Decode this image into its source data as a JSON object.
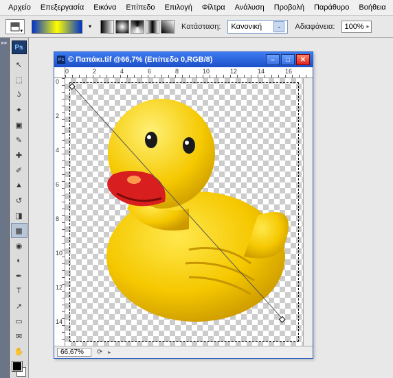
{
  "menubar": [
    "Αρχείο",
    "Επεξεργασία",
    "Εικόνα",
    "Επίπεδο",
    "Επιλογή",
    "Φίλτρα",
    "Ανάλυση",
    "Προβολή",
    "Παράθυρο",
    "Βοήθεια"
  ],
  "options": {
    "mode_label": "Κατάσταση:",
    "mode_value": "Κανονική",
    "opacity_label": "Αδιαφάνεια:",
    "opacity_value": "100%"
  },
  "document": {
    "title": "© Παπάκι.tif @66,7% (Επίπεδο 0,RGB/8)",
    "zoom": "66,67%",
    "ruler_h": [
      "0",
      "2",
      "4",
      "6",
      "8",
      "10",
      "12",
      "14",
      "16"
    ],
    "ruler_v": [
      "0",
      "2",
      "4",
      "6",
      "8",
      "10",
      "12",
      "14"
    ]
  },
  "tools": [
    "move",
    "marquee",
    "lasso",
    "wand",
    "crop",
    "eyedropper",
    "heal",
    "brush",
    "stamp",
    "history",
    "eraser",
    "gradient",
    "blur",
    "dodge",
    "pen",
    "type",
    "path",
    "shape",
    "notes",
    "hand"
  ],
  "icons": {
    "move": "↖",
    "marquee": "⬚",
    "lasso": "ʖ",
    "wand": "✦",
    "crop": "▣",
    "eyedropper": "✎",
    "heal": "✚",
    "brush": "✐",
    "stamp": "▲",
    "history": "↺",
    "eraser": "◨",
    "gradient": "▦",
    "blur": "◉",
    "dodge": "◐",
    "pen": "✒",
    "type": "T",
    "path": "↗",
    "shape": "▭",
    "notes": "✉",
    "hand": "✋"
  }
}
